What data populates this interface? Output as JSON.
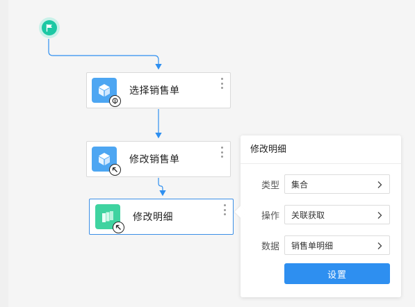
{
  "flow": {
    "nodes": [
      {
        "label": "选择销售单",
        "icon": "cube-icon",
        "badge": "touch-icon",
        "color": "#4da6f2"
      },
      {
        "label": "修改销售单",
        "icon": "cube-icon",
        "badge": "cursor-arrow-icon",
        "color": "#4da6f2"
      },
      {
        "label": "修改明细",
        "icon": "stack-icon",
        "badge": "cursor-arrow-icon",
        "color": "#3fd3a0"
      }
    ],
    "start_icon": "flag-icon",
    "line_color": "#2e8ff0"
  },
  "panel": {
    "title": "修改明细",
    "rows": [
      {
        "label": "类型",
        "value": "集合"
      },
      {
        "label": "操作",
        "value": "关联获取"
      },
      {
        "label": "数据",
        "value": "销售单明细"
      }
    ],
    "button_label": "设置",
    "button_color": "#2e8ff0"
  }
}
